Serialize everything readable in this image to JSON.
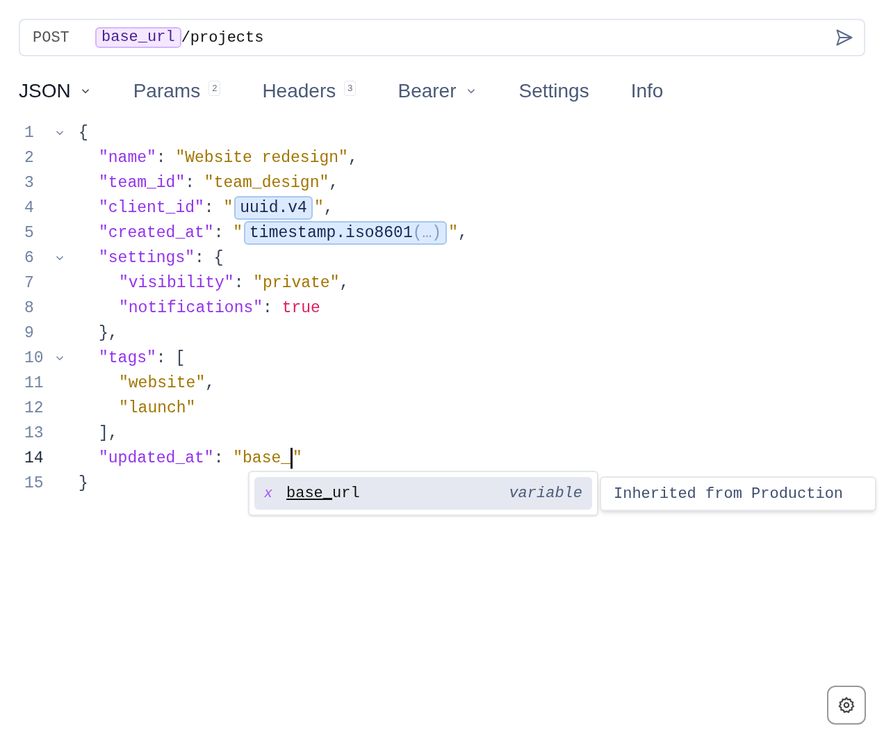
{
  "request": {
    "method": "POST",
    "url": [
      {
        "kind": "variable",
        "text": "base_url"
      },
      {
        "kind": "path",
        "text": "/projects"
      }
    ]
  },
  "tabs": [
    {
      "label": "JSON",
      "selected": true,
      "menu": true
    },
    {
      "label": "Params",
      "selected": false,
      "badge": "2"
    },
    {
      "label": "Headers",
      "selected": false,
      "badge": "3"
    },
    {
      "label": "Bearer",
      "selected": false,
      "menu": true
    },
    {
      "label": "Settings",
      "selected": false
    },
    {
      "label": "Info",
      "selected": false
    }
  ],
  "editor": {
    "lines": [
      {
        "number": "1",
        "fold": true,
        "current": false,
        "tokens": [
          {
            "kind": "punct",
            "text": "{"
          }
        ]
      },
      {
        "number": "2",
        "fold": false,
        "current": false,
        "tokens": [
          {
            "kind": "key",
            "text": "\"name\""
          },
          {
            "kind": "punct",
            "text": ": "
          },
          {
            "kind": "str",
            "text": "\"Website redesign\""
          },
          {
            "kind": "punct",
            "text": ","
          }
        ]
      },
      {
        "number": "3",
        "fold": false,
        "current": false,
        "tokens": [
          {
            "kind": "key",
            "text": "\"team_id\""
          },
          {
            "kind": "punct",
            "text": ": "
          },
          {
            "kind": "str",
            "text": "\"team_design\""
          },
          {
            "kind": "punct",
            "text": ","
          }
        ]
      },
      {
        "number": "4",
        "fold": false,
        "current": false,
        "tokens": [
          {
            "kind": "key",
            "text": "\"client_id\""
          },
          {
            "kind": "punct",
            "text": ": "
          },
          {
            "kind": "str",
            "text": "\""
          },
          {
            "kind": "chip",
            "text": "uuid.v4"
          },
          {
            "kind": "str",
            "text": "\""
          },
          {
            "kind": "punct",
            "text": ","
          }
        ]
      },
      {
        "number": "5",
        "fold": false,
        "current": false,
        "tokens": [
          {
            "kind": "key",
            "text": "\"created_at\""
          },
          {
            "kind": "punct",
            "text": ": "
          },
          {
            "kind": "str",
            "text": "\""
          },
          {
            "kind": "chip",
            "text": "timestamp.iso8601",
            "args": "(…)"
          },
          {
            "kind": "str",
            "text": "\""
          },
          {
            "kind": "punct",
            "text": ","
          }
        ]
      },
      {
        "number": "6",
        "fold": true,
        "current": false,
        "tokens": [
          {
            "kind": "key",
            "text": "\"settings\""
          },
          {
            "kind": "punct",
            "text": ": {"
          }
        ]
      },
      {
        "number": "7",
        "fold": false,
        "current": false,
        "tokens": [
          {
            "kind": "key",
            "text": "\"visibility\""
          },
          {
            "kind": "punct",
            "text": ": "
          },
          {
            "kind": "str",
            "text": "\"private\""
          },
          {
            "kind": "punct",
            "text": ","
          }
        ]
      },
      {
        "number": "8",
        "fold": false,
        "current": false,
        "tokens": [
          {
            "kind": "key",
            "text": "\"notifications\""
          },
          {
            "kind": "punct",
            "text": ": "
          },
          {
            "kind": "bool",
            "text": "true"
          }
        ]
      },
      {
        "number": "9",
        "fold": false,
        "current": false,
        "tokens": [
          {
            "kind": "punct",
            "text": "},"
          }
        ]
      },
      {
        "number": "10",
        "fold": true,
        "current": false,
        "tokens": [
          {
            "kind": "key",
            "text": "\"tags\""
          },
          {
            "kind": "punct",
            "text": ": ["
          }
        ]
      },
      {
        "number": "11",
        "fold": false,
        "current": false,
        "tokens": [
          {
            "kind": "str",
            "text": "\"website\""
          },
          {
            "kind": "punct",
            "text": ","
          }
        ]
      },
      {
        "number": "12",
        "fold": false,
        "current": false,
        "tokens": [
          {
            "kind": "str",
            "text": "\"launch\""
          }
        ]
      },
      {
        "number": "13",
        "fold": false,
        "current": false,
        "tokens": [
          {
            "kind": "punct",
            "text": "],"
          }
        ]
      },
      {
        "number": "14",
        "fold": false,
        "current": true,
        "tokens": [
          {
            "kind": "key",
            "text": "\"updated_at\""
          },
          {
            "kind": "punct",
            "text": ": "
          },
          {
            "kind": "str",
            "text": "\"base_"
          },
          {
            "kind": "cursor"
          },
          {
            "kind": "str",
            "text": "\""
          }
        ]
      },
      {
        "number": "15",
        "fold": false,
        "current": false,
        "tokens": [
          {
            "kind": "punct",
            "text": "}"
          }
        ]
      }
    ]
  },
  "autocomplete": {
    "items": [
      {
        "icon": "x",
        "matched": "base_",
        "rest": "url",
        "type": "variable",
        "selected": true
      }
    ],
    "detail": "Inherited from Production"
  }
}
